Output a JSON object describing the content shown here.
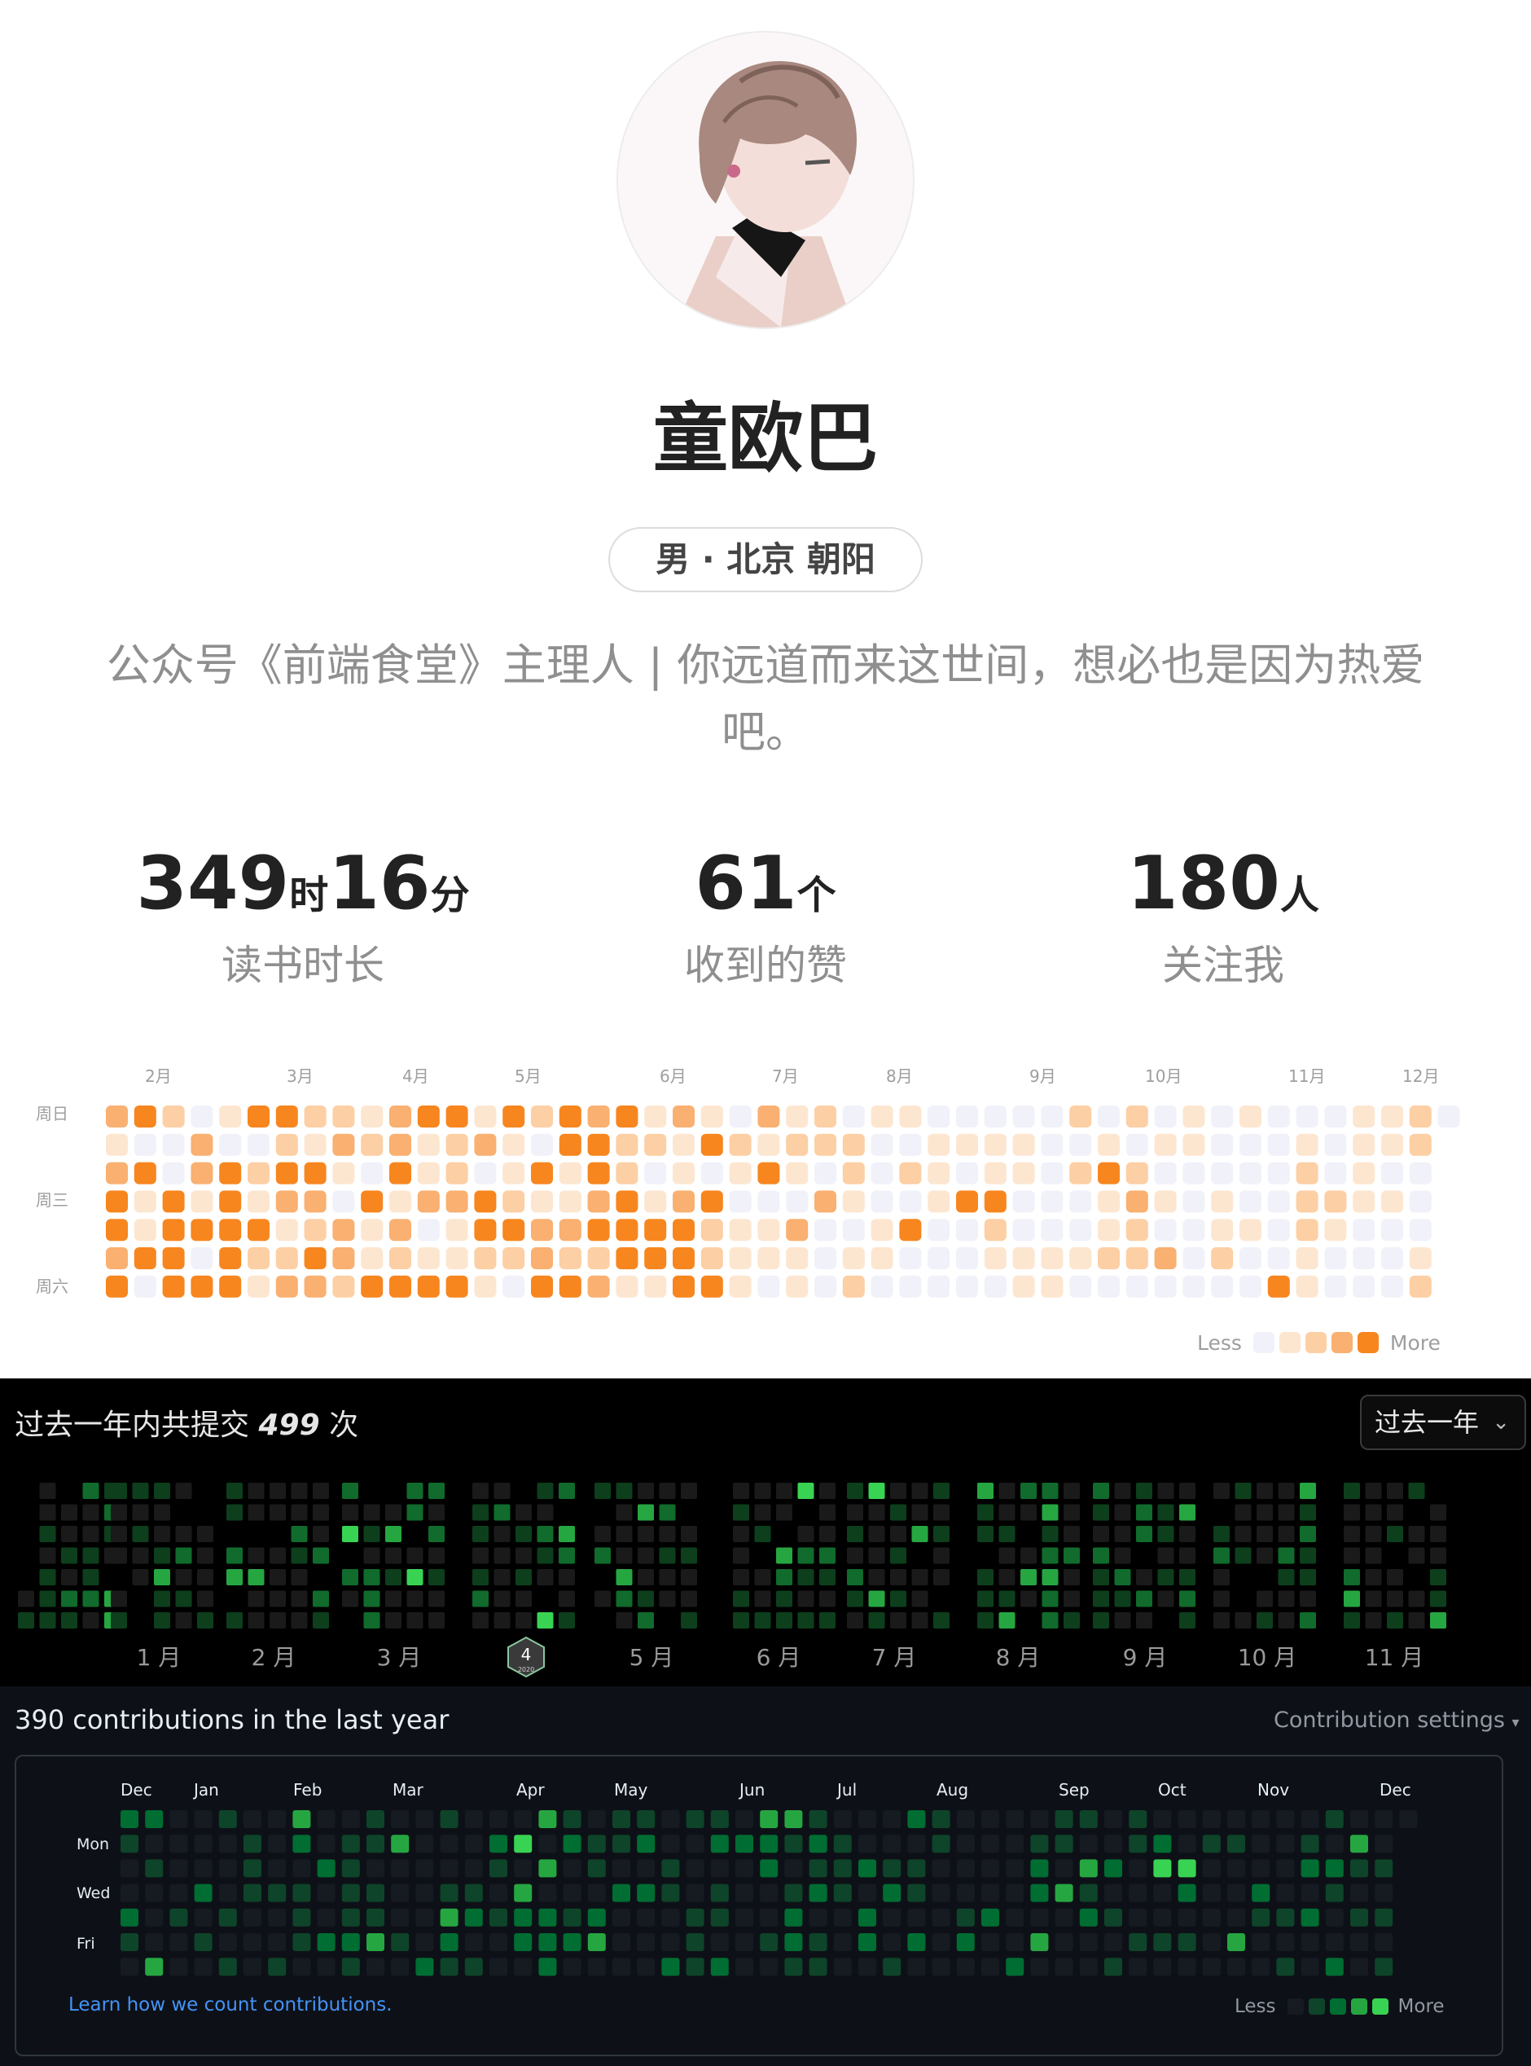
{
  "profile": {
    "name": "童欧巴",
    "tag": "男 · 北京 朝阳",
    "bio": "公众号《前端食堂》主理人 | 你远道而来这世间，想必也是因为热爱吧。"
  },
  "stats": [
    {
      "value1": "349",
      "unit1": "时",
      "value2": "16",
      "unit2": "分",
      "label": "读书时长"
    },
    {
      "value1": "61",
      "unit1": "个",
      "label": "收到的赞"
    },
    {
      "value1": "180",
      "unit1": "人",
      "label": "关注我"
    }
  ],
  "reading_heatmap": {
    "months": [
      "2月",
      "3月",
      "4月",
      "5月",
      "6月",
      "7月",
      "8月",
      "9月",
      "10月",
      "11月",
      "12月"
    ],
    "weekdays": [
      "周日",
      "周三",
      "周六"
    ],
    "legend_less": "Less",
    "legend_more": "More",
    "colors": [
      "#f1f1fa",
      "#fde6d0",
      "#fdcfa4",
      "#f9b071",
      "#f7861f"
    ]
  },
  "commit_panel": {
    "title_prefix": "过去一年内共提交",
    "count": "499",
    "title_suffix": "次",
    "range_label": "过去一年",
    "months": [
      "1 月",
      "2 月",
      "3 月",
      "5 月",
      "6 月",
      "7 月",
      "8 月",
      "9 月",
      "10 月",
      "11 月"
    ],
    "badge_number": "4",
    "badge_year": "2020",
    "colors": [
      "#1a1a1a",
      "#0d3f1c",
      "#106b2c",
      "#26a641",
      "#39d353"
    ]
  },
  "github": {
    "title": "390 contributions in the last year",
    "settings_label": "Contribution settings",
    "months": [
      "Dec",
      "Jan",
      "Feb",
      "Mar",
      "Apr",
      "May",
      "Jun",
      "Jul",
      "Aug",
      "Sep",
      "Oct",
      "Nov",
      "Dec"
    ],
    "weekdays": [
      "Mon",
      "Wed",
      "Fri"
    ],
    "link": "Learn how we count contributions.",
    "legend_less": "Less",
    "legend_more": "More",
    "colors": [
      "#161b22",
      "#0e4429",
      "#006d32",
      "#26a641",
      "#39d353"
    ]
  },
  "icons": {
    "avatar": "anime-boy-avatar",
    "chevron": "chevron-down-icon",
    "badge": "hexagon-badge-icon",
    "caret": "caret-down-icon"
  }
}
